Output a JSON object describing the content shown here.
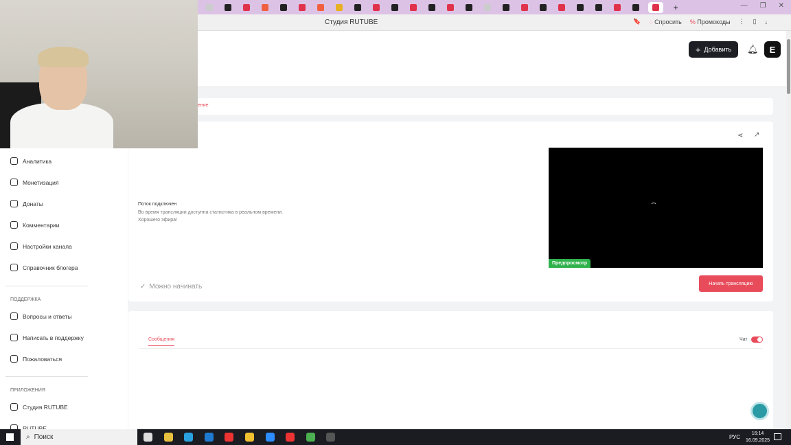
{
  "browser": {
    "tab_count": 25,
    "page_title": "Студия RUTUBE",
    "ask_label": "Спросить",
    "promo_label": "Промокоды"
  },
  "header": {
    "add_label": "Добавить",
    "logo_letter": "E"
  },
  "tabs": {
    "active_partial": "ение"
  },
  "sidebar": {
    "items": [
      "Аналитика",
      "Монетизация",
      "Донаты",
      "Комментарии",
      "Настройки канала",
      "Справочник блогера"
    ],
    "support_title": "ПОДДЕРЖКА",
    "support_items": [
      "Вопросы и ответы",
      "Написать в поддержку",
      "Пожаловаться"
    ],
    "apps_title": "ПРИЛОЖЕНИЯ",
    "apps_items": [
      "Студия RUTUBE",
      "RUTUBE"
    ]
  },
  "stream": {
    "status_title": "Поток подключен",
    "status_text": "Во время трансляции доступна статистика в реальном времени.",
    "status_wish": "Хорошего эфира!",
    "ready_label": "Можно начинать",
    "preview_label": "Предпросмотр",
    "start_label": "Начать трансляцию"
  },
  "chat": {
    "messages_tab": "Сообщения",
    "chat_label": "Чат",
    "chat_enabled": true
  },
  "taskbar": {
    "search_placeholder": "Поиск",
    "lang": "РУС",
    "time": "16:14",
    "date": "16.09.2025"
  },
  "colors": {
    "accent": "#e84c5b",
    "preview": "#2fb14b"
  }
}
